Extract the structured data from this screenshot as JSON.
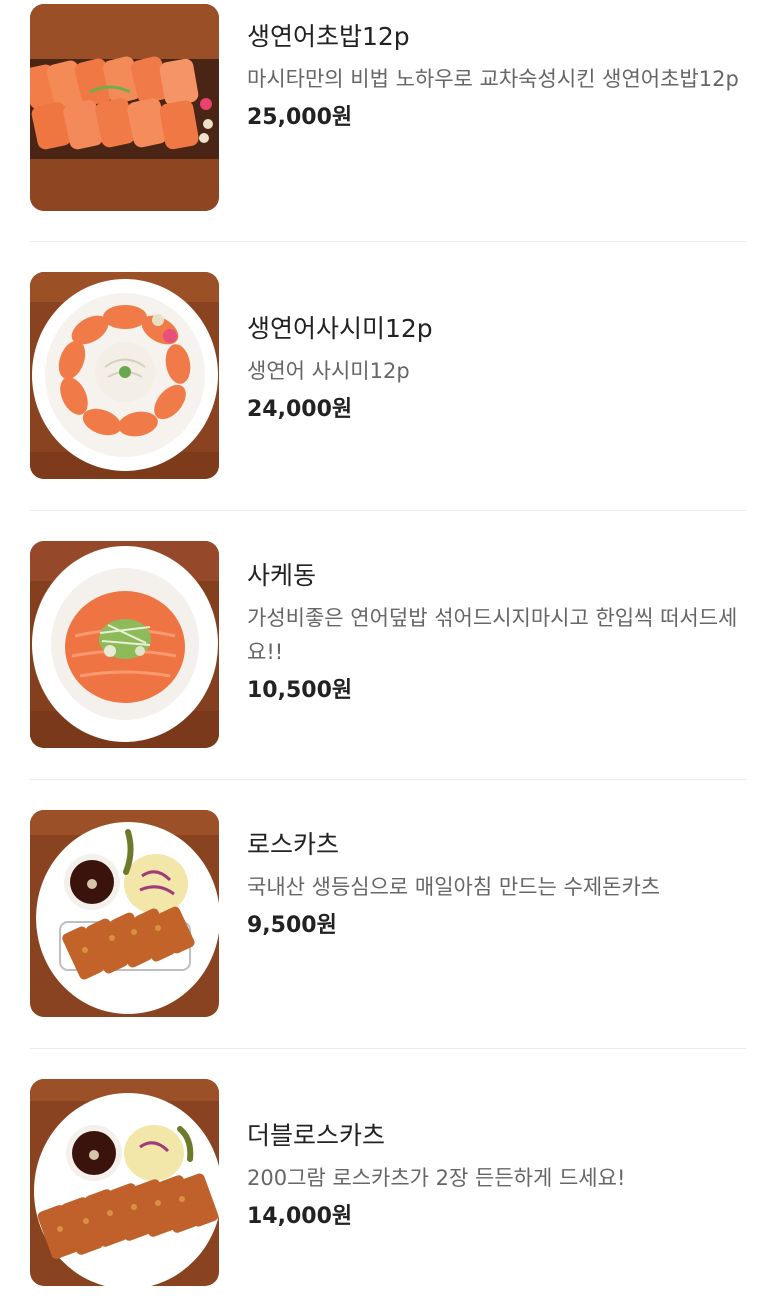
{
  "menu": {
    "items": [
      {
        "name": "생연어초밥12p",
        "description": "마시타만의 비법 노하우로 교차숙성시킨 생연어초밥12p",
        "price": "25,000원",
        "image_icon": "salmon-sushi-photo"
      },
      {
        "name": "생연어사시미12p",
        "description": "생연어 사시미12p",
        "price": "24,000원",
        "image_icon": "salmon-sashimi-photo"
      },
      {
        "name": "사케동",
        "description": "가성비좋은 연어덮밥 섞어드시지마시고 한입씩 떠서드세요!!",
        "price": "10,500원",
        "image_icon": "sake-don-photo"
      },
      {
        "name": "로스카츠",
        "description": "국내산 생등심으로 매일아침 만드는 수제돈카츠",
        "price": "9,500원",
        "image_icon": "rosu-katsu-photo"
      },
      {
        "name": "더블로스카츠",
        "description": "200그람 로스카츠가 2장 든든하게 드세요!",
        "price": "14,000원",
        "image_icon": "double-rosu-katsu-photo"
      }
    ]
  },
  "colors": {
    "text_primary": "#222222",
    "text_secondary": "#666666",
    "divider": "#ececec",
    "wood": "#7a3a1c",
    "salmon": "#f07a4a",
    "katsu": "#c2662a"
  }
}
